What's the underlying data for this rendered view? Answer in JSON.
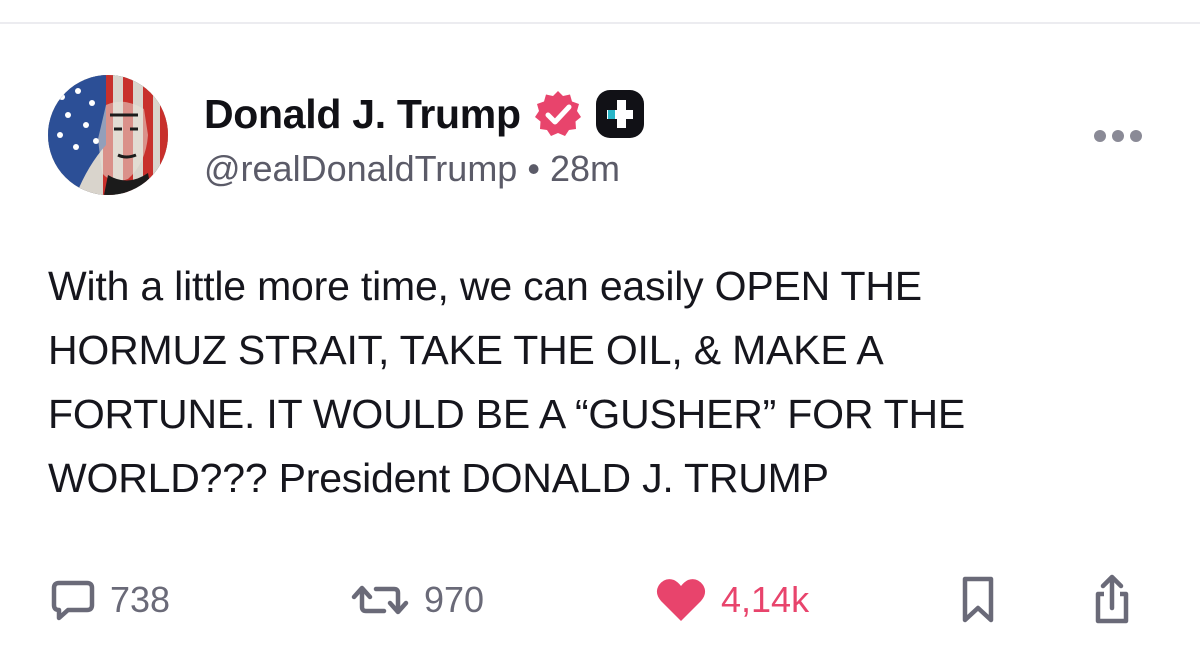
{
  "post": {
    "author": {
      "display_name": "Donald J. Trump",
      "handle": "@realDonaldTrump",
      "verified_icon": "verified-badge-icon",
      "badge_icon": "plus-badge-icon"
    },
    "separator": "•",
    "timestamp": "28m",
    "body_lines": [
      "With a little more time, we can easily OPEN THE",
      "HORMUZ STRAIT, TAKE THE OIL, & MAKE A",
      "FORTUNE. IT WOULD BE A “GUSHER” FOR THE",
      "WORLD??? President DONALD J. TRUMP"
    ],
    "stats": {
      "replies": "738",
      "reposts": "970",
      "likes": "4,14k"
    }
  },
  "colors": {
    "like": "#e8446c",
    "verified": "#e8446c",
    "muted": "#5b5b68",
    "text": "#16161d"
  }
}
